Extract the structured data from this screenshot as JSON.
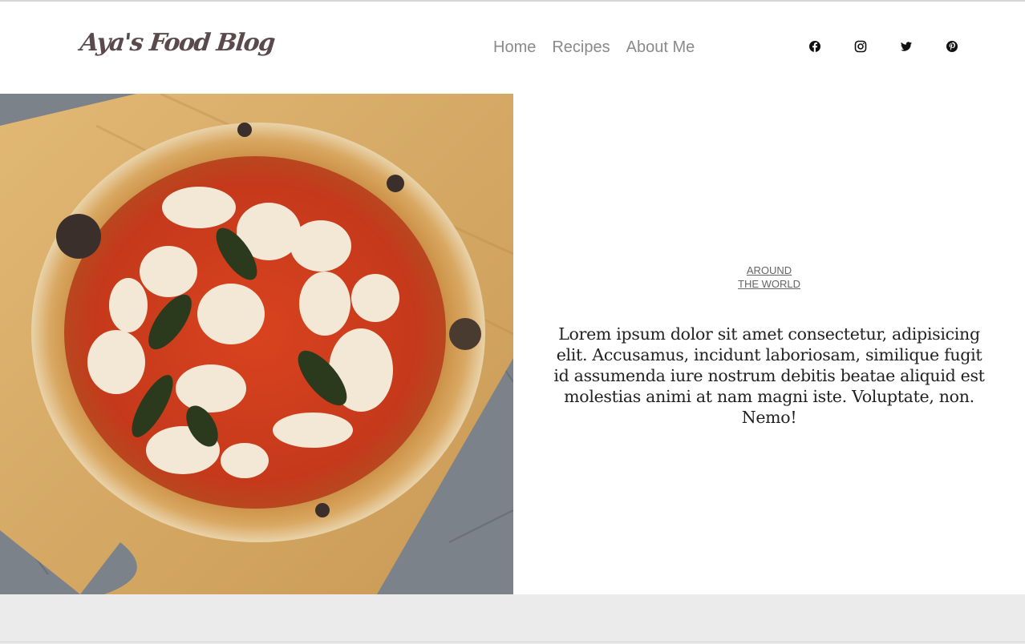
{
  "header": {
    "logo_text": "Aya's Food Blog",
    "nav": [
      "Home",
      "Recipes",
      "About Me"
    ],
    "socials": [
      {
        "name": "facebook-icon"
      },
      {
        "name": "instagram-icon"
      },
      {
        "name": "twitter-icon"
      },
      {
        "name": "pinterest-icon"
      }
    ]
  },
  "hero": {
    "image_subject": "margherita-pizza",
    "category_line1": "AROUND",
    "category_line2": "THE WORLD",
    "excerpt": "Lorem ipsum dolor sit amet consectetur, adipisicing elit. Accusamus, incidunt laboriosam, similique fugit id assumenda iure nostrum debitis beatae aliquid est molestias animi at nam magni iste. Voluptate, non. Nemo!"
  },
  "colors": {
    "logo": "#5a4a4e",
    "nav": "#8a8a8a",
    "text": "#222222",
    "footer_band": "#ebebeb"
  }
}
